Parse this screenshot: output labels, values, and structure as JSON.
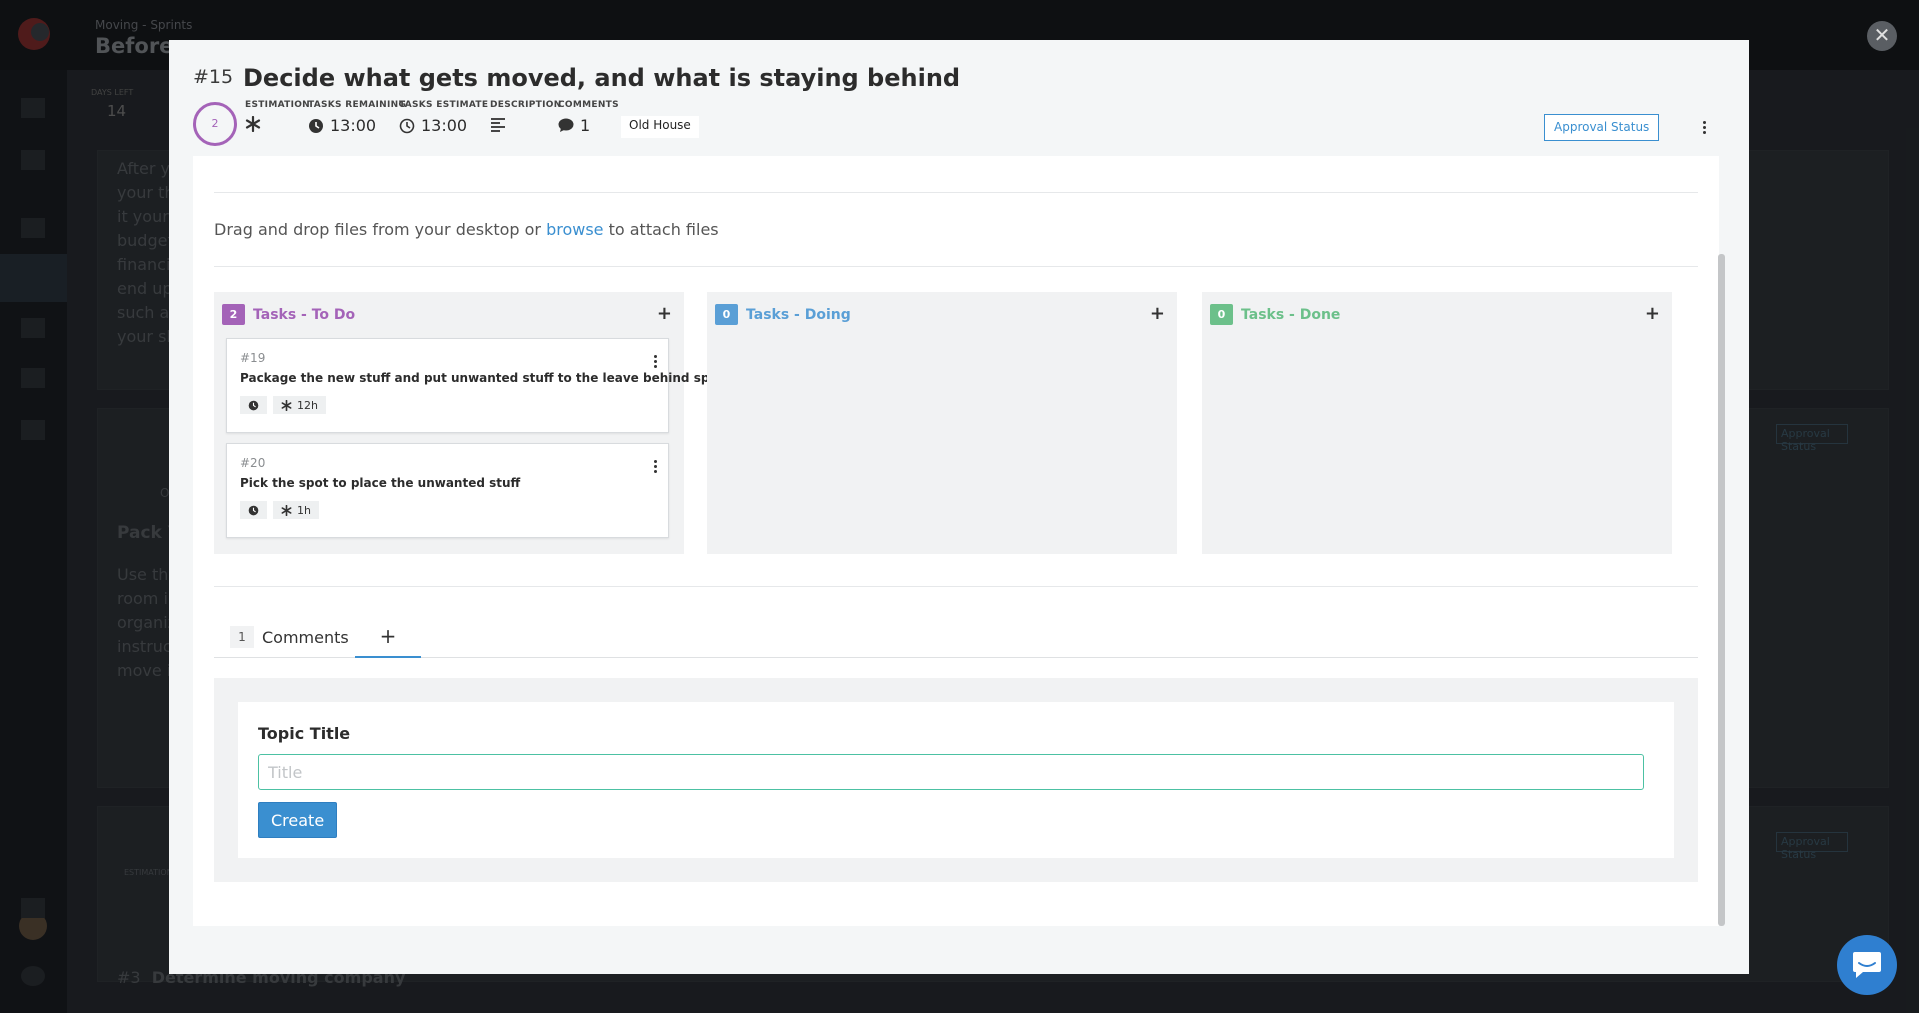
{
  "background": {
    "breadcrumb": "Moving - Sprints",
    "title": "Before",
    "days_left_label": "DAYS LEFT",
    "days_left_value": "14",
    "paragraph_lines": [
      "After y",
      "your th",
      "it yours",
      "budget",
      "financi",
      "end up",
      "such as",
      "your sh"
    ],
    "item_tag": "Old Ho",
    "item_heading": "Pack Y",
    "item_lines": [
      "Use the",
      "room i",
      "organiz",
      "instruc",
      "move i"
    ],
    "approval_label": "Approval Status",
    "estimation_label": "ESTIMATION",
    "bottom_item_num": "#3",
    "bottom_item_title": "Determine moving company"
  },
  "modal": {
    "issue_number": "#15",
    "issue_title": "Decide what gets moved, and what is staying behind",
    "points": "2",
    "meta": {
      "estimation_label": "ESTIMATION",
      "tasks_remaining_label": "TASKS REMAINING",
      "tasks_remaining_value": "13:00",
      "tasks_estimate_label": "TASKS ESTIMATE",
      "tasks_estimate_value": "13:00",
      "description_label": "DESCRIPTION",
      "comments_label": "COMMENTS",
      "comments_value": "1"
    },
    "tag": "Old House",
    "approval_button": "Approval Status",
    "dropzone": {
      "before": "Drag and drop files from your desktop or ",
      "link": "browse",
      "after": " to attach files"
    },
    "boards": [
      {
        "count": "2",
        "title": "Tasks - To Do",
        "color": "#a463b8",
        "tasks": [
          {
            "num": "#19",
            "title": "Package the new stuff and put unwanted stuff to the leave behind spot",
            "estimate": "12h"
          },
          {
            "num": "#20",
            "title": "Pick the spot to place the unwanted stuff",
            "estimate": "1h"
          }
        ]
      },
      {
        "count": "0",
        "title": "Tasks - Doing",
        "color": "#5a9fd6",
        "tasks": []
      },
      {
        "count": "0",
        "title": "Tasks - Done",
        "color": "#6cc08a",
        "tasks": []
      }
    ],
    "tabs": {
      "comments_count": "1",
      "comments_label": "Comments",
      "add_label": "+"
    },
    "topic": {
      "label": "Topic Title",
      "placeholder": "Title",
      "value": "",
      "create_button": "Create"
    }
  },
  "close_label": "✕",
  "colors": {
    "accent": "#3a8fd0",
    "todo": "#a463b8",
    "doing": "#5a9fd6",
    "done": "#6cc08a",
    "focus": "#4cc1a3"
  }
}
